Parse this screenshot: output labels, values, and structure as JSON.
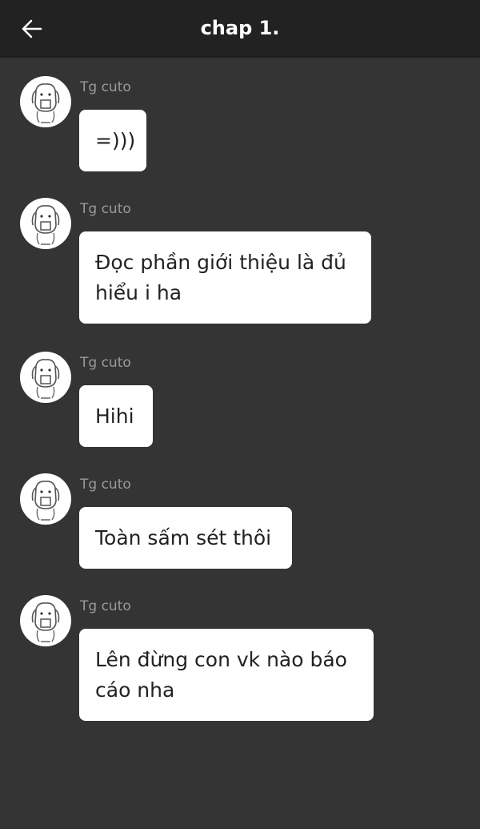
{
  "header": {
    "title": "chap 1."
  },
  "messages": [
    {
      "sender": "Tg cuto",
      "text": "=)))"
    },
    {
      "sender": "Tg cuto",
      "text": "Đọc phần giới thiệu là đủ hiểu i ha"
    },
    {
      "sender": "Tg cuto",
      "text": "Hihi"
    },
    {
      "sender": "Tg cuto",
      "text": "Toàn sấm sét thôi"
    },
    {
      "sender": "Tg cuto",
      "text": "Lên đừng con vk nào báo cáo nha"
    }
  ],
  "colors": {
    "background": "#343434",
    "header": "#222222",
    "bubble": "#ffffff",
    "sender": "#9a9a9a"
  }
}
